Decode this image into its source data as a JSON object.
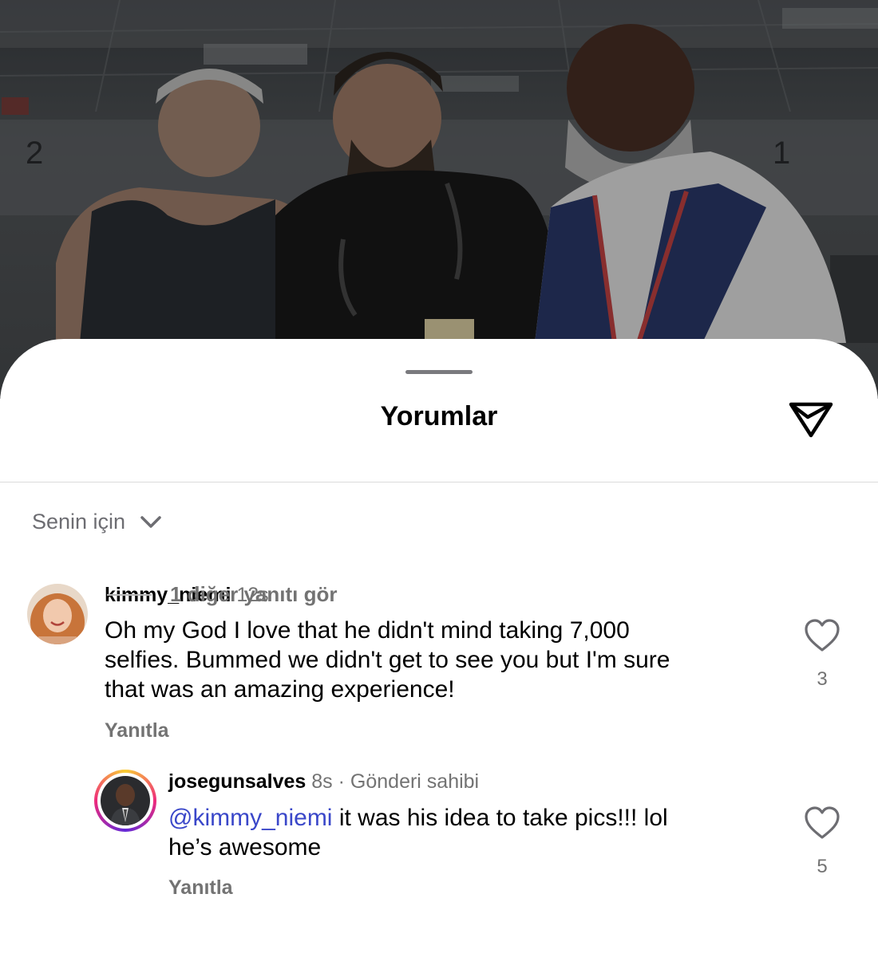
{
  "header": {
    "title": "Yorumlar",
    "share_icon": "paper-plane-icon"
  },
  "filter": {
    "label": "Senin için",
    "icon": "chevron-down-icon"
  },
  "comments": [
    {
      "username": "kimmy_niemi",
      "time": "12s",
      "text": "Oh my God I love that he didn't mind taking 7,000 selfies. Bummed we didn't get to see you but I'm sure that was an amazing experience!",
      "text_lines": [
        "Oh my God I love that he didn't mind taking 7,000",
        "selfies. Bummed we didn't get to see you but I'm sure",
        "that was an amazing experience!"
      ],
      "reply_label": "Yanıtla",
      "likes": "3",
      "like_icon": "heart-outline-icon"
    }
  ],
  "replies": [
    {
      "username": "josegunsalves",
      "time": "8s",
      "separator": "·",
      "badge": "Gönderi sahibi",
      "mention": "@kimmy_niemi",
      "text_line1": "it was his idea to take pics!!! lol",
      "text_line2": "he’s awesome",
      "reply_label": "Yanıtla",
      "likes": "5",
      "like_icon": "heart-outline-icon"
    }
  ],
  "more_replies": "1 diğer yanıtı gör",
  "colors": {
    "mention": "#3a47c9",
    "meta": "#737373",
    "story_ring": [
      "#f9ce34",
      "#ee2a7b",
      "#6228d7"
    ]
  }
}
